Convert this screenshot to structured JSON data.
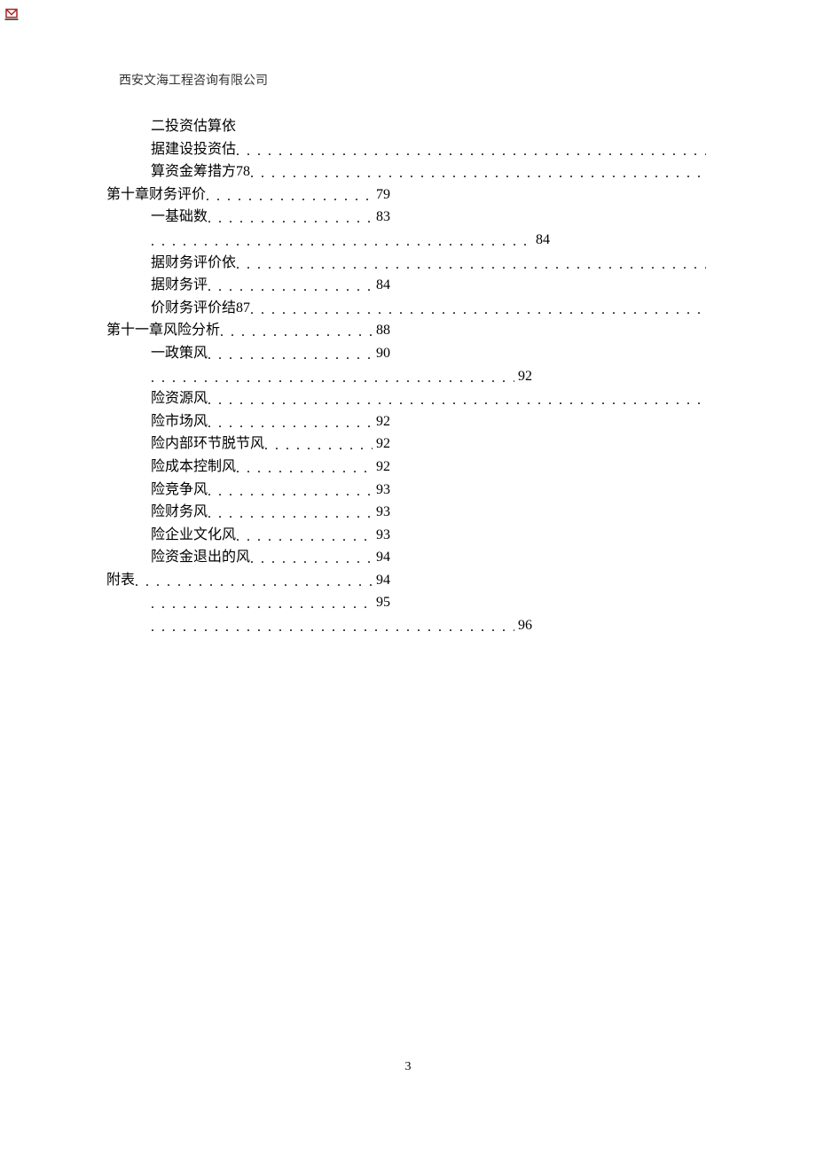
{
  "header": {
    "company": "西安文海工程咨询有限公司"
  },
  "page_number": "3",
  "toc": {
    "lines": [
      {
        "indent": 1,
        "label": "二投资估算依",
        "page": "",
        "pad": "0",
        "nodots": true
      },
      {
        "indent": 1,
        "label": "据建设投资估",
        "page": "",
        "pad": "0"
      },
      {
        "indent": 1,
        "label": "算资金筹措方78",
        "page": "",
        "pad": "0"
      },
      {
        "indent": 0,
        "label": "第十章财务评价",
        "page": "79",
        "pad": "360"
      },
      {
        "indent": 1,
        "label": "一基础数",
        "page": "83",
        "pad": "360"
      },
      {
        "indent": 1,
        "label": "",
        "page": "84",
        "pad": "180"
      },
      {
        "indent": 1,
        "label": "据财务评价依",
        "page": "",
        "pad": "0"
      },
      {
        "indent": 1,
        "label": "据财务评",
        "page": "84",
        "pad": "360"
      },
      {
        "indent": 1,
        "label": "价财务评价结87",
        "page": "",
        "pad": "0"
      },
      {
        "indent": 0,
        "label": "第十一章风险分析",
        "page": "88",
        "pad": "360"
      },
      {
        "indent": 1,
        "label": "一政策风",
        "page": "90",
        "pad": "360"
      },
      {
        "indent": 1,
        "label": "",
        "page": "92",
        "pad": "200"
      },
      {
        "indent": 1,
        "label": "险资源风",
        "page": "",
        "pad": "0"
      },
      {
        "indent": 1,
        "label": "险市场风",
        "page": "92",
        "pad": "360"
      },
      {
        "indent": 1,
        "label": "险内部环节脱节风",
        "page": "92",
        "pad": "360"
      },
      {
        "indent": 1,
        "label": "险成本控制风",
        "page": "92",
        "pad": "360"
      },
      {
        "indent": 1,
        "label": "险竞争风",
        "page": "93",
        "pad": "360"
      },
      {
        "indent": 1,
        "label": "险财务风",
        "page": "93",
        "pad": "360"
      },
      {
        "indent": 1,
        "label": "险企业文化风",
        "page": "93",
        "pad": "360"
      },
      {
        "indent": 1,
        "label": "险资金退出的风",
        "page": "94",
        "pad": "360"
      },
      {
        "indent": 0,
        "label": "附表",
        "page": "94",
        "pad": "360"
      },
      {
        "indent": 1,
        "label": "",
        "page": "95",
        "pad": "360"
      },
      {
        "indent": 1,
        "label": "",
        "page": "96",
        "pad": "200"
      }
    ]
  }
}
